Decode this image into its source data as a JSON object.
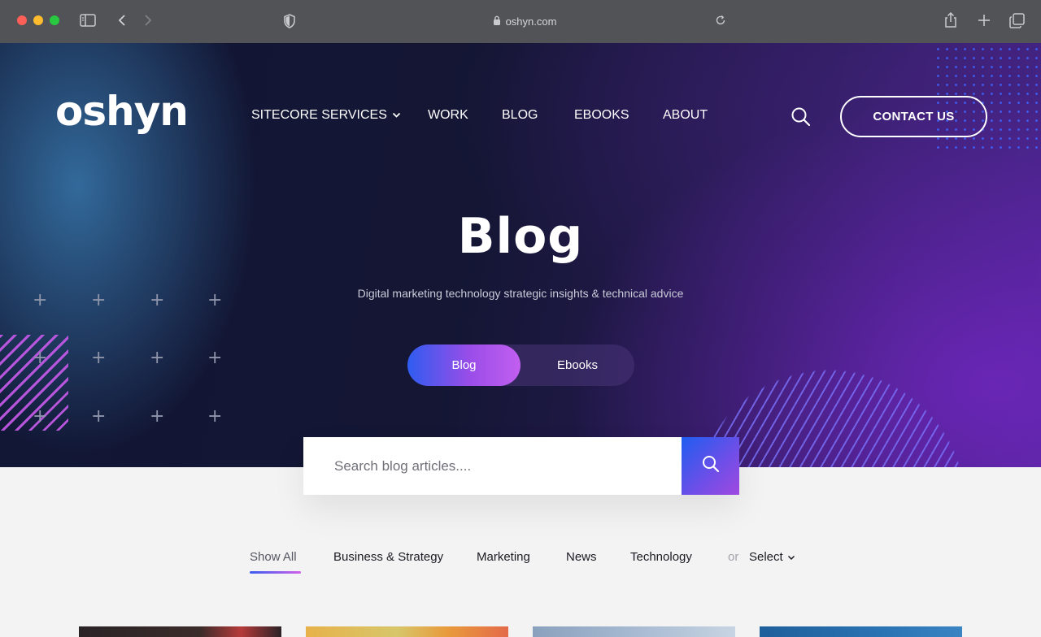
{
  "browser": {
    "url": "oshyn.com"
  },
  "header": {
    "logo": "oshyn",
    "nav": [
      {
        "label": "SITECORE SERVICES"
      },
      {
        "label": "WORK"
      },
      {
        "label": "BLOG"
      },
      {
        "label": "EBOOKS"
      },
      {
        "label": "ABOUT"
      }
    ],
    "contact_label": "CONTACT US"
  },
  "hero": {
    "title": "Blog",
    "subtitle": "Digital marketing technology strategic insights & technical advice",
    "toggle": {
      "active": "Blog",
      "inactive": "Ebooks"
    }
  },
  "search": {
    "placeholder": "Search blog articles...."
  },
  "filters": {
    "items": [
      "Show All",
      "Business & Strategy",
      "Marketing",
      "News",
      "Technology"
    ],
    "or_label": "or",
    "select_label": "Select"
  },
  "colors": {
    "accent_blue": "#2f5cf0",
    "accent_purple": "#c25ff0",
    "hero_dark": "#141634"
  }
}
